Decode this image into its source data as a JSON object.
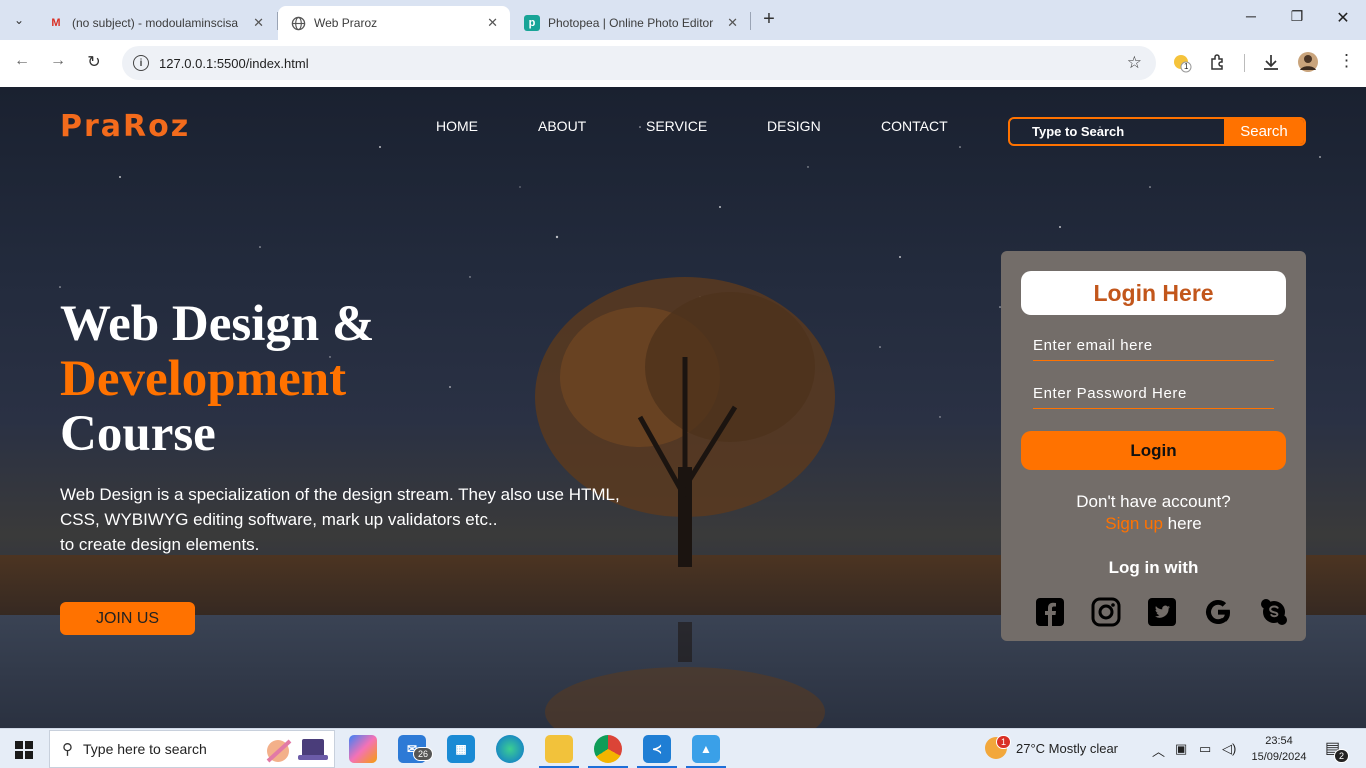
{
  "browser": {
    "tabs": [
      {
        "title": "(no subject) - modoulaminscisa",
        "favicon": "gmail-icon",
        "active": false
      },
      {
        "title": "Web Praroz",
        "favicon": "globe-icon",
        "active": true
      },
      {
        "title": "Photopea | Online Photo Editor",
        "favicon": "photopea-icon",
        "active": false
      }
    ],
    "url": "127.0.0.1:5500/index.html"
  },
  "site": {
    "logo": "PraRoz",
    "nav": [
      "HOME",
      "ABOUT",
      "SERVICE",
      "DESIGN",
      "CONTACT"
    ],
    "search": {
      "placeholder": "Type to Search",
      "button": "Search"
    },
    "hero": {
      "line1": "Web Design &",
      "line2": "Development",
      "line3": "Course",
      "text_line1": "Web Design is a specialization of the design stream. They also use HTML,",
      "text_line2": "CSS, WYBIWYG editing software, mark up validators etc..",
      "text_line3": "to create design elements.",
      "cta": "JOIN US"
    },
    "login": {
      "heading": "Login Here",
      "email_placeholder": "Enter email here",
      "password_placeholder": "Enter Password Here",
      "button": "Login",
      "no_account": "Don't have account?",
      "signup": "Sign up",
      "signup_suffix": " here",
      "login_with": "Log in with",
      "social": [
        "facebook-icon",
        "instagram-icon",
        "twitter-icon",
        "google-icon",
        "skype-icon"
      ]
    },
    "colors": {
      "accent": "#ff7200",
      "card": "#736d69"
    }
  },
  "taskbar": {
    "search_label": "Type here to search",
    "mail_badge": "26",
    "weather": "27°C  Mostly clear",
    "weather_badge": "1",
    "time": "23:54",
    "date": "15/09/2024",
    "notifications": "2",
    "extension_badge": "1"
  }
}
